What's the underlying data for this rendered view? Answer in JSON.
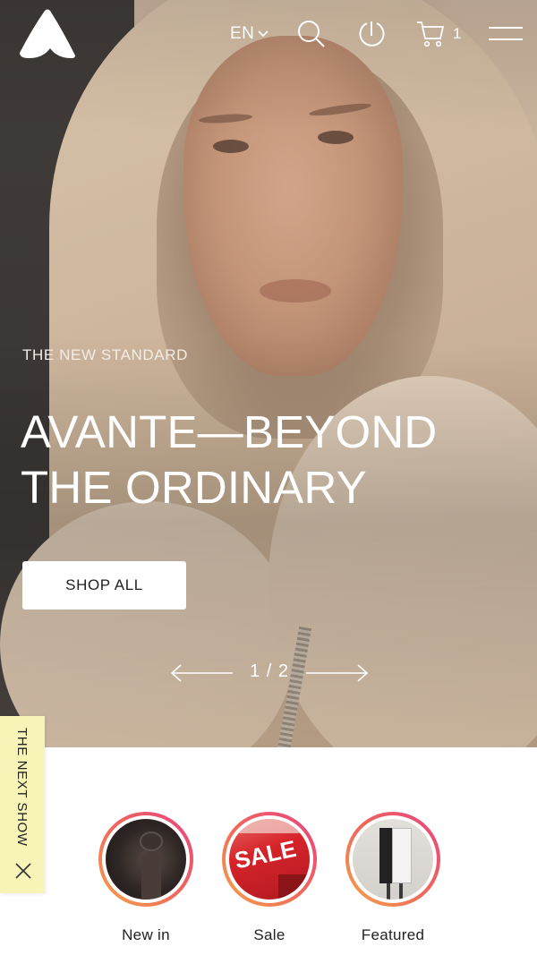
{
  "header": {
    "language": "EN",
    "cart_count": "1",
    "icons": [
      "logo-icon",
      "chevron-down-icon",
      "search-icon",
      "clock-icon",
      "cart-icon",
      "menu-icon"
    ]
  },
  "hero": {
    "eyebrow": "THE NEW STANDARD",
    "headline_line1": "AVANTE—BEYOND",
    "headline_line2": "THE ORDINARY",
    "cta_label": "SHOP ALL",
    "pager": "1 / 2"
  },
  "side_tab": {
    "label": "THE NEXT SHOW"
  },
  "stories": [
    {
      "label": "New in"
    },
    {
      "label": "Sale"
    },
    {
      "label": "Featured"
    }
  ],
  "sale_image_text": "SALE",
  "colors": {
    "side_tab_bg": "#f8f4b8",
    "story_ring_start": "#f6a54a",
    "story_ring_end": "#e8447f",
    "hero_dark": "#3b3735"
  }
}
